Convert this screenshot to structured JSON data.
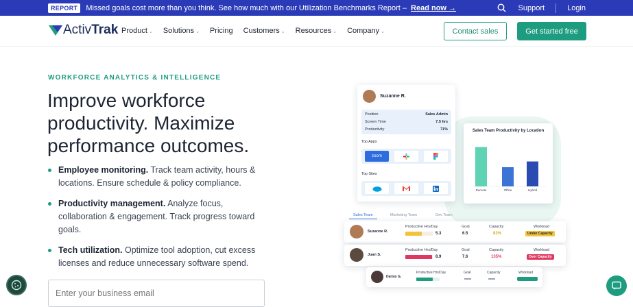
{
  "banner": {
    "badge": "REPORT",
    "message": "Missed goals cost more than you think. See how much with our Utilization Benchmarks Report –",
    "link": "Read now →",
    "support": "Support",
    "login": "Login"
  },
  "nav": {
    "logo": {
      "prefix": "Activ",
      "suffix": "Trak"
    },
    "items": [
      "Product",
      "Solutions",
      "Pricing",
      "Customers",
      "Resources",
      "Company"
    ],
    "contact": "Contact sales",
    "cta": "Get started free"
  },
  "hero": {
    "eyebrow": "WORKFORCE ANALYTICS & INTELLIGENCE",
    "headline": "Improve workforce productivity. Maximize performance outcomes.",
    "bullets": [
      {
        "title": "Employee monitoring.",
        "text": " Track team activity, hours & locations. Ensure schedule & policy compliance."
      },
      {
        "title": "Productivity management.",
        "text": " Analyze focus, collaboration & engagement. Track progress toward goals."
      },
      {
        "title": "Tech utilization.",
        "text": " Optimize tool adoption, cut excess licenses and reduce unnecessary software spend."
      }
    ],
    "email_placeholder": "Enter your business email"
  },
  "profile_card": {
    "name": "Suzanne R.",
    "rows": [
      {
        "label": "Position",
        "value": "Sales Admin"
      },
      {
        "label": "Screen Time",
        "value": "7.5 hrs"
      },
      {
        "label": "Productivity",
        "value": "71%"
      }
    ],
    "top_apps_label": "Top Apps",
    "apps": [
      "zoom"
    ],
    "top_sites_label": "Top Sites"
  },
  "chart_data": {
    "type": "bar",
    "title": "Sales Team Productivity by Location",
    "categories": [
      "Remote",
      "Office",
      "Hybrid"
    ],
    "values": [
      82,
      40,
      52
    ],
    "colors": [
      "#5fd3b3",
      "#3c74d6",
      "#2a4bb2"
    ]
  },
  "team_tabs": [
    "Sales Team",
    "Marketing Team",
    "Dev Team"
  ],
  "workload": {
    "headers": {
      "hours": "Productive Hrs/Day",
      "goal": "Goal",
      "capacity": "Capacity",
      "workload": "Workload"
    },
    "rows": [
      {
        "name": "Suzanne R.",
        "hours": "5.3",
        "goal": "6.5",
        "capacity": "82%",
        "workload": "Under Capacity",
        "bar_fill": 0.6,
        "bar_color": "#f2c33d"
      },
      {
        "name": "Juan S.",
        "hours": "8.9",
        "goal": "7.6",
        "capacity": "135%",
        "workload": "Over Capacity",
        "bar_fill": 0.98,
        "bar_color": "#e0365f"
      },
      {
        "name": "Darius G.",
        "hours": "",
        "goal": "",
        "capacity": "",
        "workload": "",
        "bar_fill": 0.7,
        "bar_color": "#1e9c80"
      }
    ]
  }
}
